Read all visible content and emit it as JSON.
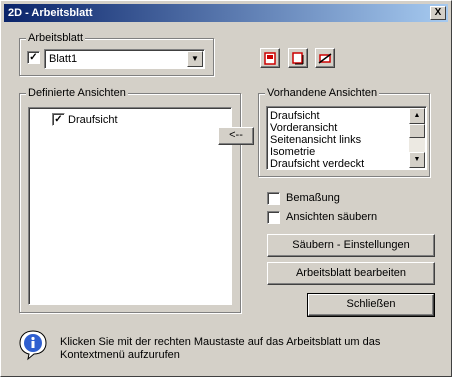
{
  "window": {
    "title": "2D - Arbeitsblatt",
    "close_glyph": "X"
  },
  "arbeitsblatt_group": {
    "label": "Arbeitsblatt",
    "checked": true,
    "selected_value": "Blatt1"
  },
  "toolbar": {
    "icons": [
      "new-sheet-icon",
      "copy-sheet-icon",
      "delete-sheet-icon"
    ]
  },
  "definierte_group": {
    "label": "Definierte Ansichten",
    "items": [
      {
        "label": "Draufsicht",
        "checked": true
      }
    ]
  },
  "move_button": {
    "label": "<--"
  },
  "vorhandene_group": {
    "label": "Vorhandene Ansichten",
    "items": [
      "Draufsicht",
      "Vorderansicht",
      "Seitenansicht links",
      "Isometrie",
      "Draufsicht verdeckt"
    ]
  },
  "options": {
    "bemassung": "Bemaßung",
    "ansichten_saeubern": "Ansichten säubern"
  },
  "buttons": {
    "saeubern_einstellungen": "Säubern - Einstellungen",
    "arbeitsblatt_bearbeiten": "Arbeitsblatt bearbeiten",
    "schliessen": "Schließen"
  },
  "info": {
    "text": "Klicken Sie mit der rechten Maustaste auf das Arbeitsblatt um das Kontextmenü aufzurufen"
  },
  "colors": {
    "title_start": "#0a246a",
    "title_end": "#a6caf0",
    "face": "#d4d0c8",
    "icon_red": "#cc0000"
  }
}
